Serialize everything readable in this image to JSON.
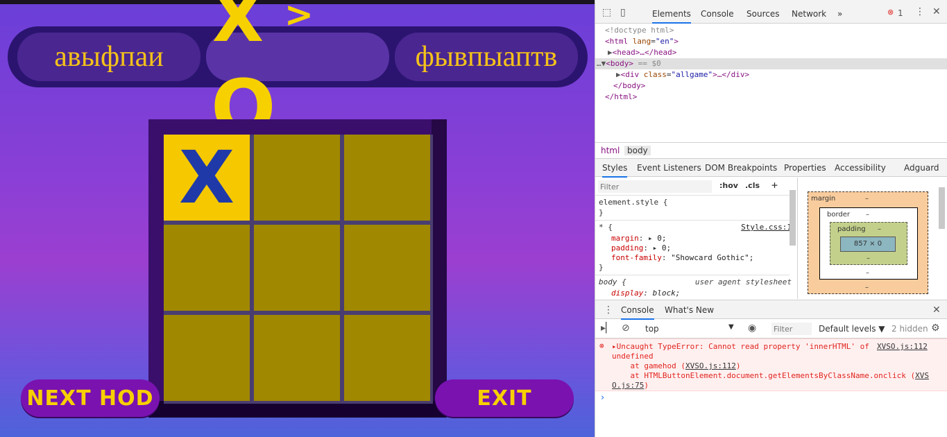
{
  "game": {
    "player1": "авыфпаи",
    "player2": "фывпыаптв",
    "big_x": "X",
    "big_arrow": ">",
    "big_o": "O",
    "cells": [
      "X",
      "",
      "",
      "",
      "",
      "",
      "",
      "",
      ""
    ],
    "next_label": "NEXT HOD",
    "exit_label": "EXIT",
    "colors": {
      "accent": "#f7d000",
      "mark": "#1f3aa8",
      "cell": "#a08800",
      "active_cell": "#f5c800"
    }
  },
  "devtools": {
    "tabs": [
      "Elements",
      "Console",
      "Sources",
      "Network"
    ],
    "more": "»",
    "error_count": "1",
    "dom": {
      "doctype": "<!doctype html>",
      "html_open": "<html",
      "html_attr": "lang",
      "html_val": "\"en\"",
      "head": "<head>…</head>",
      "body_open": "<body>",
      "body_eq": "== $0",
      "div_open": "<div",
      "div_attr": "class",
      "div_val": "\"allgame\"",
      "div_rest": ">…</div>",
      "body_close": "</body>",
      "html_close": "</html>"
    },
    "breadcrumbs": [
      "html",
      "body"
    ],
    "style_tabs": [
      "Styles",
      "Event Listeners",
      "DOM Breakpoints",
      "Properties",
      "Accessibility",
      "Adguard"
    ],
    "filter_placeholder": "Filter",
    "hov": ":hov",
    "cls": ".cls",
    "plus": "+",
    "css": {
      "element_style": "element.style {",
      "close": "}",
      "star": "* {",
      "star_src": "Style.css:1",
      "margin_prop": "margin",
      "margin_val": "0;",
      "padding_prop": "padding",
      "padding_val": "0;",
      "font_prop": "font-family",
      "font_val": "\"Showcard Gothic\";",
      "body_sel": "body {",
      "body_src": "user agent stylesheet",
      "display_prop": "display",
      "display_val": "block;"
    },
    "box_model": {
      "margin": "margin",
      "border": "border",
      "padding": "padding",
      "content": "857 × 0",
      "dash": "–"
    },
    "console_tabs": [
      "Console",
      "What's New"
    ],
    "context": "top",
    "console_filter": "Filter",
    "levels": "Default levels ▼",
    "hidden": "2 hidden",
    "error": {
      "line1": "Uncaught TypeError: Cannot read property 'innerHTML' of",
      "line1_src": "XVSO.js:112",
      "line2": "undefined",
      "line3_pre": "    at gamehod (",
      "line3_src": "XVSO.js:112",
      "line3_post": ")",
      "line4_pre": "    at HTMLButtonElement.document.getElementsByClassName.onclick (",
      "line4_src": "XVS",
      "line5_src": "O.js:75",
      "line5_post": ")"
    },
    "prompt": "›"
  }
}
